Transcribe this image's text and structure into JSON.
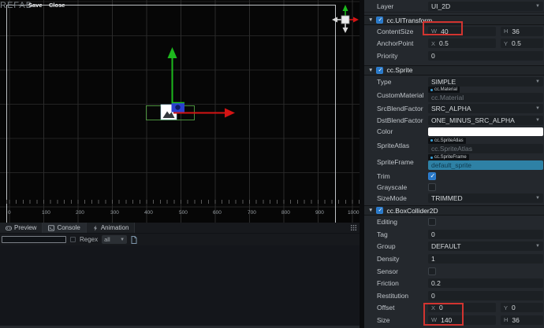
{
  "scene": {
    "title": "REFAB",
    "save_button": "Save",
    "close_button": "Close",
    "ruler_labels": [
      "0",
      "100",
      "200",
      "300",
      "400",
      "500",
      "600",
      "700",
      "800",
      "900",
      "1000"
    ]
  },
  "console": {
    "tabs": [
      {
        "label": "Preview"
      },
      {
        "label": "Console"
      },
      {
        "label": "Animation"
      }
    ],
    "search_value": "",
    "regex_label": "Regex",
    "filter_value": "all"
  },
  "inspector": {
    "prefixes": {
      "w": "W",
      "h": "H",
      "x": "X",
      "y": "Y"
    },
    "layer": {
      "label": "Layer",
      "value": "UI_2D"
    },
    "uitransform": {
      "title": "cc.UITransform",
      "enabled": true,
      "content_size": {
        "label": "ContentSize",
        "w": "40",
        "h": "36"
      },
      "anchor_point": {
        "label": "AnchorPoint",
        "x": "0.5",
        "y": "0.5"
      },
      "priority": {
        "label": "Priority",
        "value": "0"
      }
    },
    "sprite": {
      "title": "cc.Sprite",
      "enabled": true,
      "type": {
        "label": "Type",
        "value": "SIMPLE"
      },
      "custom_material": {
        "label": "CustomMaterial",
        "chip": "cc.Material",
        "placeholder": "cc.Material"
      },
      "src_blend_factor": {
        "label": "SrcBlendFactor",
        "value": "SRC_ALPHA"
      },
      "dst_blend_factor": {
        "label": "DstBlendFactor",
        "value": "ONE_MINUS_SRC_ALPHA"
      },
      "color": {
        "label": "Color",
        "value": "#FFFFFF"
      },
      "sprite_atlas": {
        "label": "SpriteAtlas",
        "chip": "cc.SpriteAtlas",
        "placeholder": "cc.SpriteAtlas"
      },
      "sprite_frame": {
        "label": "SpriteFrame",
        "chip": "cc.SpriteFrame",
        "value": "default_sprite"
      },
      "trim": {
        "label": "Trim",
        "checked": true
      },
      "grayscale": {
        "label": "Grayscale",
        "checked": false
      },
      "size_mode": {
        "label": "SizeMode",
        "value": "TRIMMED"
      }
    },
    "box_collider": {
      "title": "cc.BoxCollider2D",
      "enabled": true,
      "editing": {
        "label": "Editing",
        "checked": false
      },
      "tag": {
        "label": "Tag",
        "value": "0"
      },
      "group": {
        "label": "Group",
        "value": "DEFAULT"
      },
      "density": {
        "label": "Density",
        "value": "1"
      },
      "sensor": {
        "label": "Sensor",
        "checked": false
      },
      "friction": {
        "label": "Friction",
        "value": "0.2"
      },
      "restitution": {
        "label": "Restitution",
        "value": "0"
      },
      "offset": {
        "label": "Offset",
        "x": "0",
        "y": "0"
      },
      "size": {
        "label": "Size",
        "w": "140",
        "h": "36"
      }
    },
    "highlight_color": "#d23430"
  },
  "colors": {
    "x_axis": "#d41414",
    "y_axis": "#1db91d",
    "xy_handle": "#2a3fd0",
    "collider_outline": "#4a8f3c",
    "sprite_frame_selected_bg": "#2e81a5"
  }
}
